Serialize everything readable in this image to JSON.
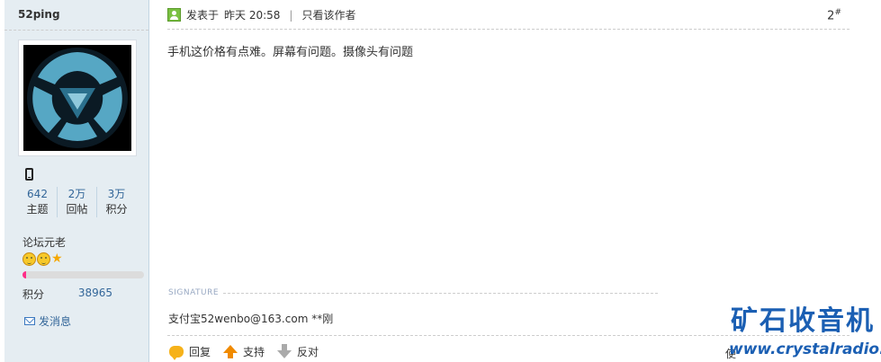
{
  "user": {
    "name": "52ping",
    "stats": [
      {
        "value": "642",
        "label": "主题"
      },
      {
        "value": "2万",
        "label": "回帖"
      },
      {
        "value": "3万",
        "label": "积分"
      }
    ],
    "group": "论坛元老",
    "level_progress_percent": 3,
    "score_label": "积分",
    "score_value": "38965",
    "send_message": "发消息"
  },
  "post": {
    "posted_prefix": "发表于",
    "posted_time": "昨天 20:58",
    "separator": "|",
    "only_author": "只看该作者",
    "floor": "2",
    "floor_mark": "#",
    "content": "手机这价格有点难。屏幕有问题。摄像头有问题",
    "signature_label": "SIGNATURE",
    "signature": "支付宝52wenbo@163.com  **刚"
  },
  "actions": {
    "reply": "回复",
    "support": "支持",
    "oppose": "反对",
    "cut_text": "使"
  },
  "watermark": {
    "title": "矿石收音机",
    "url": "www.crystalradio.cn"
  },
  "colors": {
    "sidebar_bg": "#e5edf2",
    "link": "#336699",
    "watermark": "#1b5fb3"
  }
}
